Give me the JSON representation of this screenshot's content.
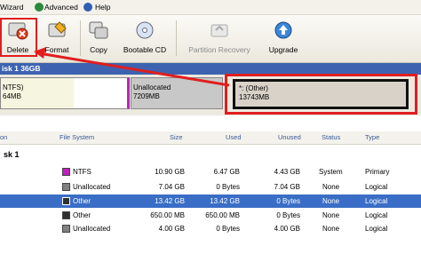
{
  "menubar": {
    "wizard": "Wizard",
    "advanced": "Advanced",
    "help": "Help"
  },
  "toolbar": {
    "delete": "Delete",
    "format": "Format",
    "copy": "Copy",
    "bootable": "Bootable CD",
    "recovery": "Partition Recovery",
    "upgrade": "Upgrade"
  },
  "disk_bar": "isk 1  36GB",
  "map": {
    "ntfs_name": "NTFS)",
    "ntfs_size": "64MB",
    "unalloc_name": "Unallocated",
    "unalloc_size": "7209MB",
    "other_name": "*: (Other)",
    "other_size": "13743MB"
  },
  "columns": {
    "partition": "on",
    "fs": "File System",
    "size": "Size",
    "used": "Used",
    "unused": "Unused",
    "status": "Status",
    "type": "Type"
  },
  "group_title": "sk 1",
  "colors": {
    "ntfs": "#c020c0",
    "gray": "#808080",
    "dark": "#303030",
    "selected": "#3a6ec6",
    "highlight": "#e01e1e"
  },
  "rows": [
    {
      "fs": "NTFS",
      "size": "10.90 GB",
      "used": "6.47 GB",
      "unused": "4.43 GB",
      "status": "System",
      "type": "Primary",
      "swatch": "#c020c0"
    },
    {
      "fs": "Unallocated",
      "size": "7.04 GB",
      "used": "0 Bytes",
      "unused": "7.04 GB",
      "status": "None",
      "type": "Logical",
      "swatch": "#808080"
    },
    {
      "fs": "Other",
      "size": "13.42 GB",
      "used": "13.42 GB",
      "unused": "0 Bytes",
      "status": "None",
      "type": "Logical",
      "swatch": "#303030"
    },
    {
      "fs": "Other",
      "size": "650.00 MB",
      "used": "650.00 MB",
      "unused": "0 Bytes",
      "status": "None",
      "type": "Logical",
      "swatch": "#303030"
    },
    {
      "fs": "Unallocated",
      "size": "4.00 GB",
      "used": "0 Bytes",
      "unused": "4.00 GB",
      "status": "None",
      "type": "Logical",
      "swatch": "#808080"
    }
  ]
}
